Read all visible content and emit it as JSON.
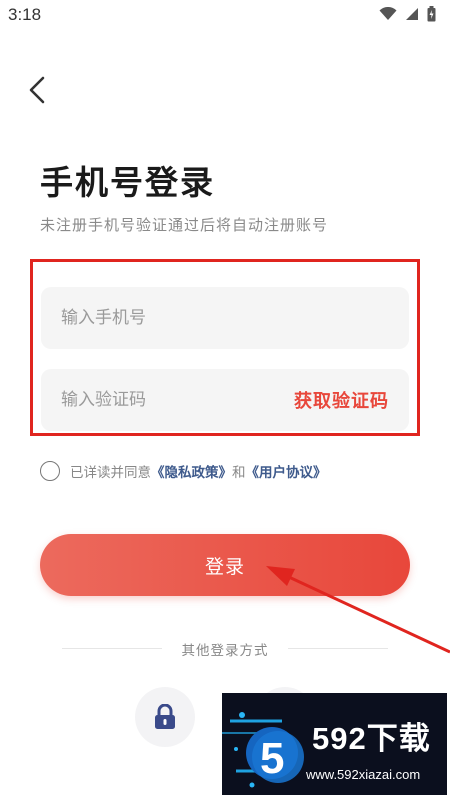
{
  "status_bar": {
    "time": "3:18",
    "icons": [
      "wifi-icon",
      "signal-icon",
      "battery-icon"
    ]
  },
  "header": {
    "back_icon": "chevron-left-icon"
  },
  "login": {
    "title": "手机号登录",
    "subtitle": "未注册手机号验证通过后将自动注册账号",
    "phone_placeholder": "输入手机号",
    "code_placeholder": "输入验证码",
    "get_code_label": "获取验证码",
    "agreement_prefix": "已详读并同意",
    "privacy_link": "《隐私政策》",
    "agreement_and": "和",
    "terms_link": "《用户协议》",
    "login_button": "登录",
    "other_login_label": "其他登录方式"
  },
  "alt_login": {
    "icons": [
      "lock-icon",
      "circle-icon"
    ]
  },
  "watermark": {
    "brand": "592下载",
    "url": "www.592xiazai.com",
    "logo_glyph": "5"
  },
  "colors": {
    "accent": "#e8473b",
    "annotation_red": "#e0251f",
    "link_blue": "#3e5a8c"
  }
}
